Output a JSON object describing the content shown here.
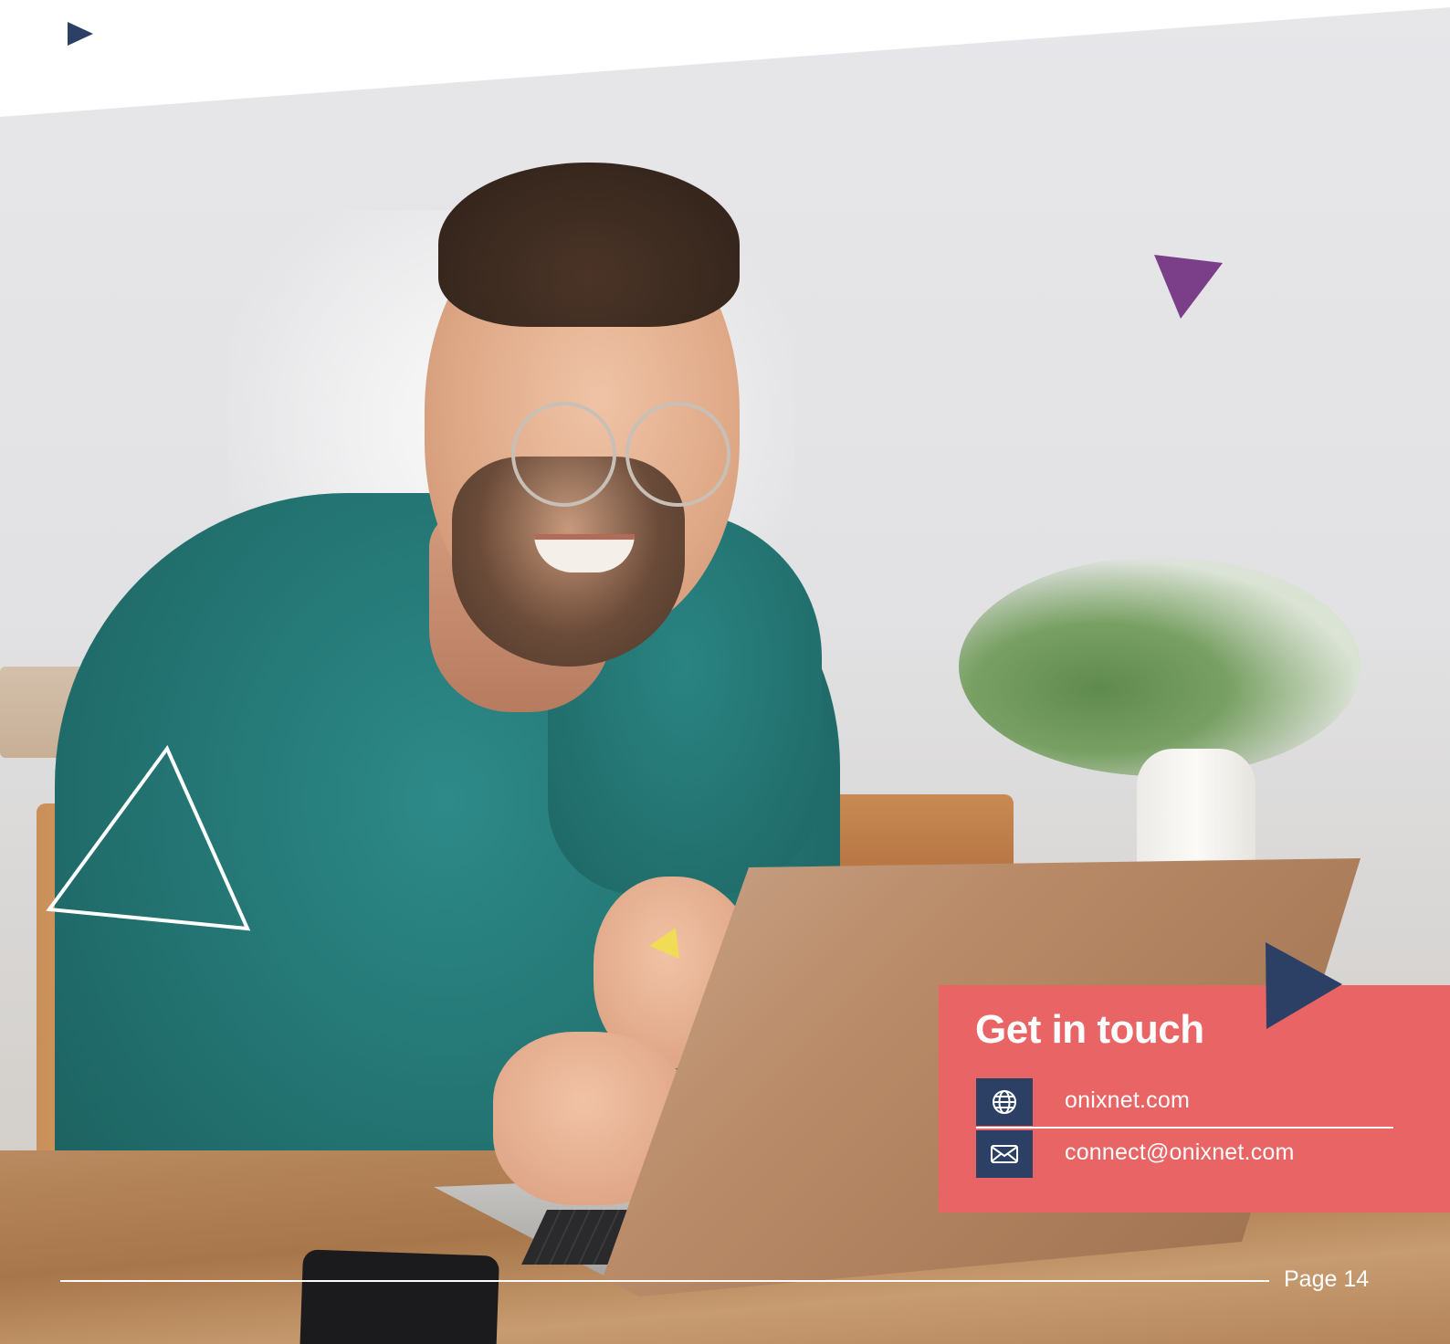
{
  "contact_card": {
    "title": "Get in touch",
    "items": [
      {
        "icon": "globe-icon",
        "text": "onixnet.com"
      },
      {
        "icon": "envelope-icon",
        "text": "connect@onixnet.com"
      }
    ]
  },
  "footer": {
    "page_label": "Page 14"
  },
  "colors": {
    "card_background": "#e96464",
    "icon_tile": "#2c4066",
    "navy_accent": "#2c4066",
    "purple_accent": "#7b3f8a",
    "yellow_accent": "#f0dc55",
    "text_light": "#ffffff"
  }
}
